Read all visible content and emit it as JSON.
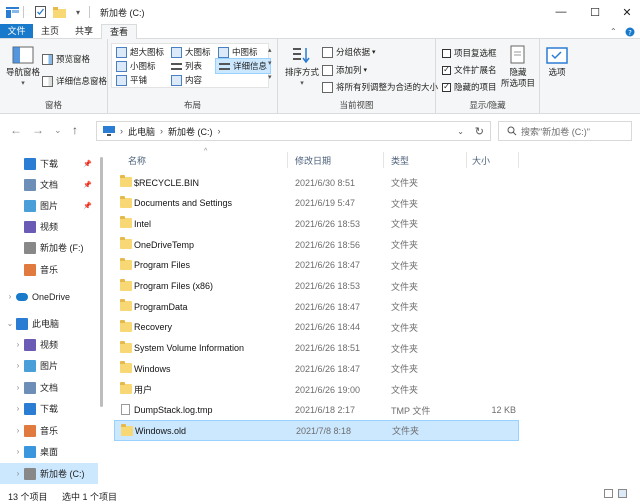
{
  "window": {
    "title": "新加卷 (C:)",
    "minimize": "—",
    "maximize": "☐",
    "close": "✕"
  },
  "ribbon_tabs": [
    "文件",
    "主页",
    "共享",
    "查看"
  ],
  "ribbon": {
    "panes": {
      "title": "窗格",
      "nav_pane": "导航窗格",
      "preview": "预览窗格",
      "details": "详细信息窗格"
    },
    "layout": {
      "title": "布局",
      "items": [
        "超大图标",
        "大图标",
        "中图标",
        "小图标",
        "列表",
        "详细信息",
        "平铺",
        "内容"
      ]
    },
    "current_view": {
      "title": "当前视图",
      "sort_by": "排序方式",
      "group_by": "分组依据",
      "add_columns": "添加列",
      "fit_columns": "将所有列调整为合适的大小"
    },
    "show_hide": {
      "title": "显示/隐藏",
      "item_checkboxes": "项目复选框",
      "file_extensions": "文件扩展名",
      "hidden_items": "隐藏的项目",
      "hide_selected_line1": "隐藏",
      "hide_selected_line2": "所选项目",
      "options": "选项"
    }
  },
  "nav": {
    "back": "←",
    "forward": "→",
    "recent": "⌄",
    "up": "↑",
    "breadcrumb": [
      "此电脑",
      "新加卷 (C:)"
    ],
    "search_placeholder": "搜索\"新加卷 (C:)\""
  },
  "navpane": [
    {
      "label": "下载",
      "icon": "download-icon",
      "pinned": true,
      "indent": 1
    },
    {
      "label": "文档",
      "icon": "documents-icon",
      "pinned": true,
      "indent": 1
    },
    {
      "label": "图片",
      "icon": "pictures-icon",
      "pinned": true,
      "indent": 1
    },
    {
      "label": "视频",
      "icon": "videos-icon",
      "pinned": false,
      "indent": 1
    },
    {
      "label": "新加卷 (F:)",
      "icon": "drive-icon",
      "pinned": false,
      "indent": 1
    },
    {
      "label": "音乐",
      "icon": "music-icon",
      "pinned": false,
      "indent": 1
    },
    {
      "label": "OneDrive",
      "icon": "onedrive-icon",
      "pinned": false,
      "indent": 0,
      "expand": true
    },
    {
      "label": "此电脑",
      "icon": "pc-icon",
      "pinned": false,
      "indent": 0,
      "expanded": true
    },
    {
      "label": "视频",
      "icon": "videos-icon",
      "pinned": false,
      "indent": 1,
      "expand": true
    },
    {
      "label": "图片",
      "icon": "pictures-icon",
      "pinned": false,
      "indent": 1,
      "expand": true
    },
    {
      "label": "文档",
      "icon": "documents-icon",
      "pinned": false,
      "indent": 1,
      "expand": true
    },
    {
      "label": "下载",
      "icon": "download-icon",
      "pinned": false,
      "indent": 1,
      "expand": true
    },
    {
      "label": "音乐",
      "icon": "music-icon",
      "pinned": false,
      "indent": 1,
      "expand": true
    },
    {
      "label": "桌面",
      "icon": "desktop-icon",
      "pinned": false,
      "indent": 1,
      "expand": true
    },
    {
      "label": "新加卷 (C:)",
      "icon": "drive-icon",
      "pinned": false,
      "indent": 1,
      "expand": true,
      "selected": true
    }
  ],
  "columns": [
    "名称",
    "修改日期",
    "类型",
    "大小"
  ],
  "files": [
    {
      "name": "$RECYCLE.BIN",
      "date": "2021/6/30 8:51",
      "type": "文件夹",
      "size": "",
      "kind": "folder"
    },
    {
      "name": "Documents and Settings",
      "date": "2021/6/19 5:47",
      "type": "文件夹",
      "size": "",
      "kind": "folder"
    },
    {
      "name": "Intel",
      "date": "2021/6/26 18:53",
      "type": "文件夹",
      "size": "",
      "kind": "folder"
    },
    {
      "name": "OneDriveTemp",
      "date": "2021/6/26 18:56",
      "type": "文件夹",
      "size": "",
      "kind": "folder"
    },
    {
      "name": "Program Files",
      "date": "2021/6/26 18:47",
      "type": "文件夹",
      "size": "",
      "kind": "folder"
    },
    {
      "name": "Program Files (x86)",
      "date": "2021/6/26 18:53",
      "type": "文件夹",
      "size": "",
      "kind": "folder"
    },
    {
      "name": "ProgramData",
      "date": "2021/6/26 18:47",
      "type": "文件夹",
      "size": "",
      "kind": "folder"
    },
    {
      "name": "Recovery",
      "date": "2021/6/26 18:44",
      "type": "文件夹",
      "size": "",
      "kind": "folder"
    },
    {
      "name": "System Volume Information",
      "date": "2021/6/26 18:51",
      "type": "文件夹",
      "size": "",
      "kind": "folder"
    },
    {
      "name": "Windows",
      "date": "2021/6/26 18:47",
      "type": "文件夹",
      "size": "",
      "kind": "folder"
    },
    {
      "name": "用户",
      "date": "2021/6/26 19:00",
      "type": "文件夹",
      "size": "",
      "kind": "folder"
    },
    {
      "name": "DumpStack.log.tmp",
      "date": "2021/6/18 2:17",
      "type": "TMP 文件",
      "size": "12 KB",
      "kind": "file"
    },
    {
      "name": "Windows.old",
      "date": "2021/7/8 8:18",
      "type": "文件夹",
      "size": "",
      "kind": "folder",
      "selected": true
    }
  ],
  "status": {
    "count": "13 个项目",
    "selected": "选中 1 个项目"
  },
  "colors": {
    "accent": "#1979ca",
    "selection": "#cce8ff",
    "folder": "#f8d775"
  }
}
